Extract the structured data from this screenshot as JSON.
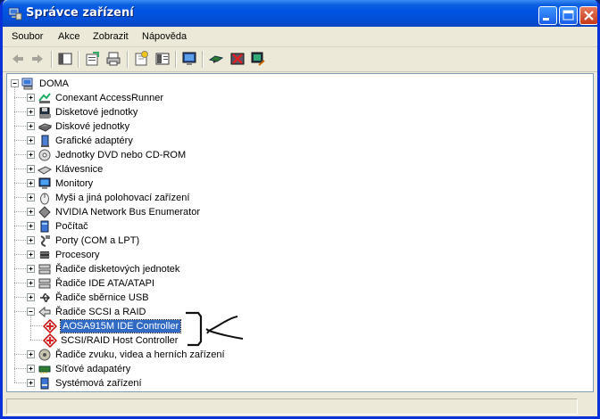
{
  "window": {
    "title": "Správce zařízení"
  },
  "menu": [
    "Soubor",
    "Akce",
    "Zobrazit",
    "Nápověda"
  ],
  "toolbar": [
    "back-icon",
    "forward-icon",
    "show-hide-tree-icon",
    "properties-icon",
    "print-icon",
    "help-icon",
    "view-icon",
    "monitor-icon",
    "scan-hardware-icon",
    "uninstall-icon",
    "update-driver-icon"
  ],
  "tree": {
    "root": "DOMA",
    "categories": [
      {
        "label": "Conexant AccessRunner",
        "icon": "modem-icon"
      },
      {
        "label": "Disketové jednotky",
        "icon": "floppy-icon"
      },
      {
        "label": "Diskové jednotky",
        "icon": "disk-icon"
      },
      {
        "label": "Grafické adaptéry",
        "icon": "display-adapter-icon"
      },
      {
        "label": "Jednotky DVD nebo CD-ROM",
        "icon": "cdrom-icon"
      },
      {
        "label": "Klávesnice",
        "icon": "keyboard-icon"
      },
      {
        "label": "Monitory",
        "icon": "monitor-icon"
      },
      {
        "label": "Myši a jiná polohovací zařízení",
        "icon": "mouse-icon"
      },
      {
        "label": "NVIDIA Network Bus Enumerator",
        "icon": "diamond-icon"
      },
      {
        "label": "Počítač",
        "icon": "computer-icon"
      },
      {
        "label": "Porty (COM a LPT)",
        "icon": "port-icon"
      },
      {
        "label": "Procesory",
        "icon": "cpu-icon"
      },
      {
        "label": "Řadiče disketových jednotek",
        "icon": "controller-icon"
      },
      {
        "label": "Řadiče IDE ATA/ATAPI",
        "icon": "controller-icon"
      },
      {
        "label": "Řadiče sběrnice USB",
        "icon": "usb-icon"
      },
      {
        "label": "Řadiče SCSI a RAID",
        "icon": "scsi-icon",
        "expanded": true,
        "children": [
          {
            "label": "AOSA915M IDE Controller",
            "icon": "scsi-device-icon",
            "selected": true
          },
          {
            "label": "SCSI/RAID Host Controller",
            "icon": "scsi-device-icon"
          }
        ]
      },
      {
        "label": "Řadiče zvuku, videa a herních zařízení",
        "icon": "sound-icon"
      },
      {
        "label": "Síťové adapatéry",
        "icon": "network-icon"
      },
      {
        "label": "Systémová zařízení",
        "icon": "system-icon"
      }
    ]
  },
  "accent": "#316ac5"
}
